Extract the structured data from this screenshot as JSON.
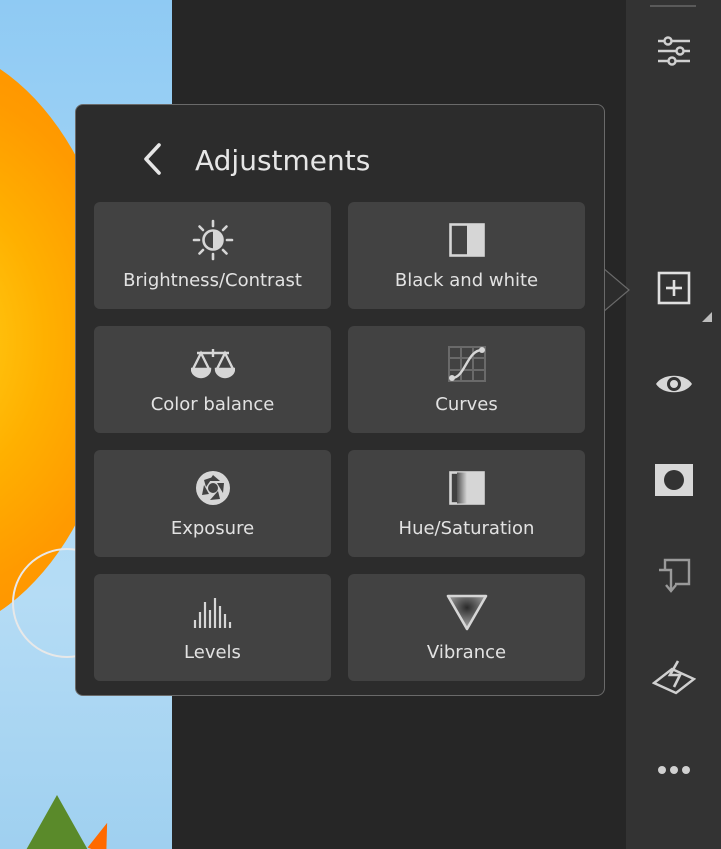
{
  "popover": {
    "title": "Adjustments",
    "tiles": [
      {
        "label": "Brightness/Contrast",
        "icon": "brightness-contrast-icon"
      },
      {
        "label": "Black and white",
        "icon": "black-and-white-icon"
      },
      {
        "label": "Color balance",
        "icon": "scale-icon"
      },
      {
        "label": "Curves",
        "icon": "curves-icon"
      },
      {
        "label": "Exposure",
        "icon": "aperture-icon"
      },
      {
        "label": "Hue/Saturation",
        "icon": "hue-saturation-icon"
      },
      {
        "label": "Levels",
        "icon": "levels-icon"
      },
      {
        "label": "Vibrance",
        "icon": "vibrance-icon"
      }
    ]
  },
  "toolbar": {
    "items": [
      {
        "name": "adjustments-sliders",
        "icon": "sliders-icon"
      },
      {
        "name": "add-layer",
        "icon": "plus-square-icon"
      },
      {
        "name": "visibility",
        "icon": "eye-icon"
      },
      {
        "name": "mask",
        "icon": "mask-icon"
      },
      {
        "name": "clipping",
        "icon": "clip-icon"
      },
      {
        "name": "layer-properties",
        "icon": "layer-lightning-icon"
      },
      {
        "name": "more",
        "icon": "more-icon"
      }
    ]
  },
  "colors": {
    "panel_bg": "#2c2c2c",
    "tile_bg": "#424242",
    "toolbar_bg": "#333333",
    "text": "#e2e2e2",
    "icon": "#d0d0d0"
  }
}
